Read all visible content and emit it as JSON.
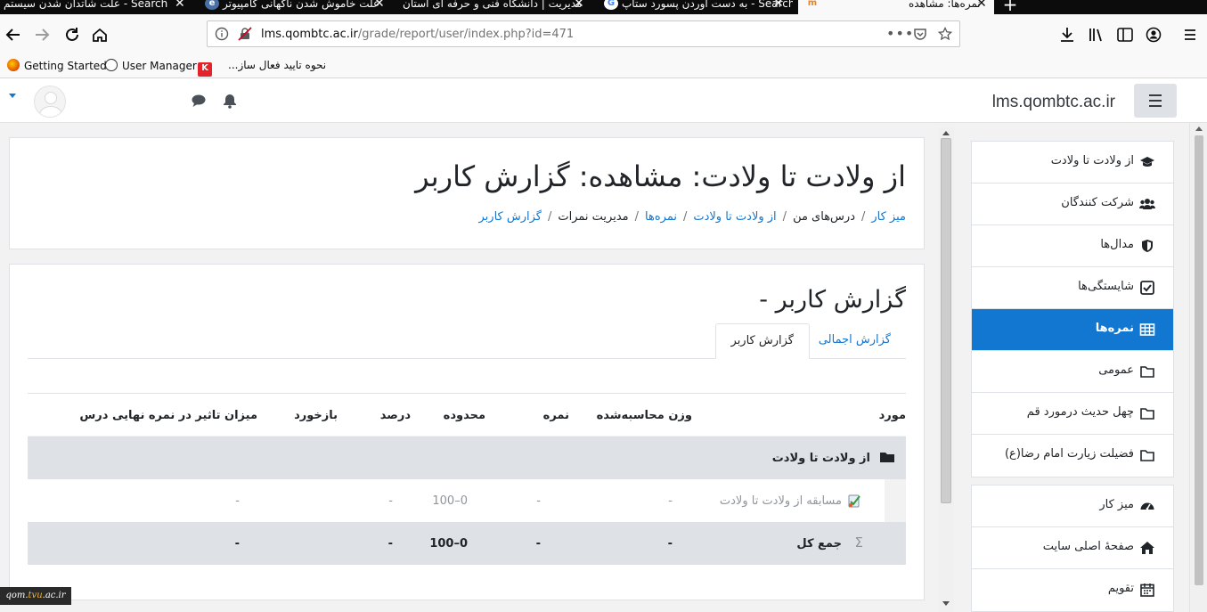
{
  "browser": {
    "tabs": [
      {
        "title": "علت شاتدان شدن سیستم - Search",
        "favicon": "search-favicon"
      },
      {
        "title": "علت خاموش شدن ناگهانی کامپیوتر",
        "favicon": "page-favicon"
      },
      {
        "title": "مدیریت | دانشگاه فنی و حرفه ای استان",
        "favicon": "page-favicon"
      },
      {
        "title": "به دست آوردن پسورد ستاپ - Search",
        "favicon": "google-favicon"
      },
      {
        "title": "نمره‌ها: مشاهده",
        "favicon": "moodle-favicon"
      }
    ],
    "url_host": "lms.qombtc.ac.ir",
    "url_path": "/grade/report/user/index.php?id=471",
    "bookmarks": [
      {
        "label": "Getting Started",
        "icon": "firefox-icon"
      },
      {
        "label": "User Manager",
        "icon": "globe-icon"
      },
      {
        "label": "",
        "icon": "k-logo-icon"
      },
      {
        "label": "نحوه تایید فعال ساز...",
        "icon": ""
      }
    ],
    "accent": "#1177d1"
  },
  "header": {
    "site_name": "lms.qombtc.ac.ir"
  },
  "drawer": {
    "course_items": [
      {
        "label": "از ولادت تا ولادت",
        "icon": "graduation-cap-icon",
        "active": false
      },
      {
        "label": "شرکت کنندگان",
        "icon": "users-icon",
        "active": false
      },
      {
        "label": "مدال‌ها",
        "icon": "shield-icon",
        "active": false
      },
      {
        "label": "شایستگی‌ها",
        "icon": "check-square-icon",
        "active": false
      },
      {
        "label": "نمره‌ها",
        "icon": "table-icon",
        "active": true
      },
      {
        "label": "عمومی",
        "icon": "folder-icon",
        "active": false
      },
      {
        "label": "چهل حدیث درمورد قم",
        "icon": "folder-icon",
        "active": false
      },
      {
        "label": "فضیلت زیارت امام رضا(ع)",
        "icon": "folder-icon",
        "active": false
      }
    ],
    "site_items": [
      {
        "label": "میز کار",
        "icon": "dashboard-icon"
      },
      {
        "label": "صفحهٔ اصلی سایت",
        "icon": "home-icon"
      },
      {
        "label": "تقویم",
        "icon": "calendar-icon"
      }
    ]
  },
  "page": {
    "title": "از ولادت تا ولادت: مشاهده: گزارش کاربر",
    "breadcrumb": [
      {
        "label": "میز کار",
        "link": true
      },
      {
        "label": "درس‌های من",
        "link": false
      },
      {
        "label": "از ولادت تا ولادت",
        "link": true
      },
      {
        "label": "نمره‌ها",
        "link": true
      },
      {
        "label": "مدیریت نمرات",
        "link": false
      },
      {
        "label": "گزارش کاربر",
        "link": true
      }
    ]
  },
  "report": {
    "heading": "گزارش کاربر -",
    "tabs": {
      "overview": "گزارش اجمالی",
      "user": "گزارش کاربر"
    },
    "columns": {
      "item": "مورد",
      "weight": "وزن محاسبه‌شده",
      "grade": "نمره",
      "range": "محدوده",
      "percent": "درصد",
      "feedback": "بازخورد",
      "contribution": "میزان تاثیر در نمره نهایی درس"
    },
    "category": {
      "name": "از ولادت تا ولادت"
    },
    "item": {
      "name": "مسابقه از ولادت تا ولادت",
      "weight": "-",
      "grade": "-",
      "range": "0–100",
      "percent": "-",
      "feedback": "",
      "contribution": "-"
    },
    "total": {
      "name": "جمع کل",
      "weight": "-",
      "grade": "-",
      "range": "0–100",
      "percent": "-",
      "feedback": "",
      "contribution": "-"
    }
  },
  "watermark": {
    "prefix": "qom.",
    "accent": "tvu",
    "suffix": ".ac.ir"
  }
}
